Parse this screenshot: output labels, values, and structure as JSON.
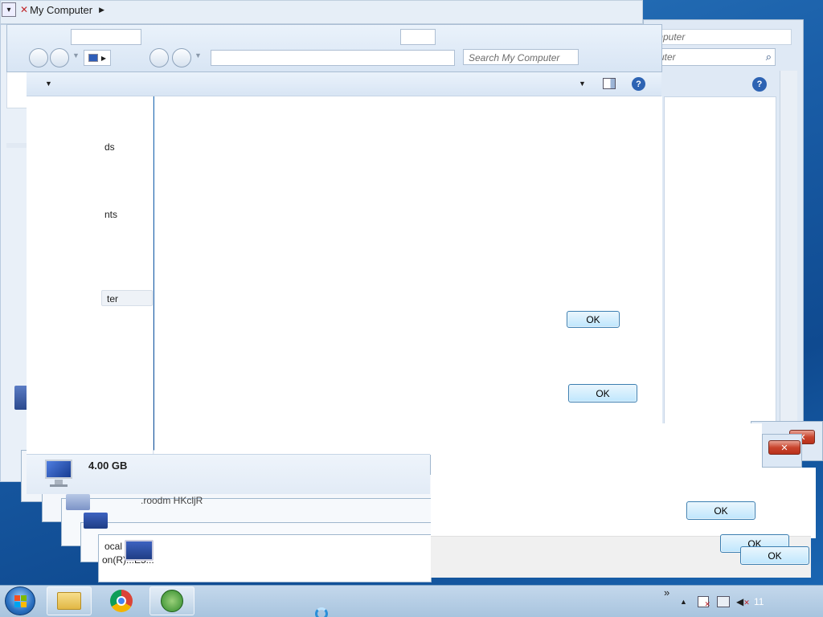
{
  "title_bar": {
    "title": "My Computer"
  },
  "search": {
    "placeholder": "Search My Computer"
  },
  "right_window": {
    "title_fragment": "mputer",
    "search_fragment": "uter"
  },
  "nav_pane": {
    "items": [
      "ds",
      "nts",
      "ter"
    ]
  },
  "details": {
    "memory": "4.00 GB",
    "text_behind": [
      ".roodm HKcljR",
      "ocal",
      "on(R)...E5..."
    ]
  },
  "dialogs": {
    "ok_label": "OK"
  },
  "taskbar": {
    "apps": [
      "start-orb",
      "windows-explorer",
      "google-chrome",
      "windows-media"
    ],
    "overflow": "»",
    "clock_fragment": "11"
  },
  "colors": {
    "accent": "#1b69b6",
    "ok_border": "#3c7fb1",
    "close_red": "#c9452e"
  }
}
